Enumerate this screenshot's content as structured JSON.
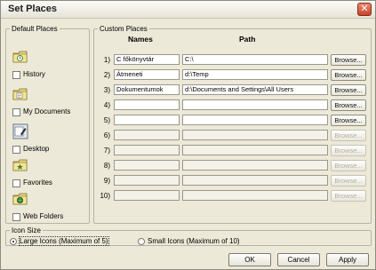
{
  "window": {
    "title": "Set Places",
    "close_glyph": "✕"
  },
  "default_places": {
    "legend": "Default Places",
    "items": [
      {
        "label": "History",
        "icon": "history-folder-icon"
      },
      {
        "label": "My Documents",
        "icon": "documents-folder-icon"
      },
      {
        "label": "Desktop",
        "icon": "desktop-icon"
      },
      {
        "label": "Favorites",
        "icon": "favorites-folder-icon"
      },
      {
        "label": "Web Folders",
        "icon": "web-folders-icon"
      }
    ]
  },
  "custom_places": {
    "legend": "Custom Places",
    "col_names": "Names",
    "col_path": "Path",
    "browse_label": "Browse...",
    "rows": [
      {
        "num": "1)",
        "name": "C főkönyvtár",
        "path": "C:\\",
        "enabled": true
      },
      {
        "num": "2)",
        "name": "Átmeneti",
        "path": "d:\\Temp",
        "enabled": true
      },
      {
        "num": "3)",
        "name": "Dokumentumok",
        "path": "d:\\Documents and Settings\\All Users",
        "enabled": true
      },
      {
        "num": "4)",
        "name": "",
        "path": "",
        "enabled": true
      },
      {
        "num": "5)",
        "name": "",
        "path": "",
        "enabled": true
      },
      {
        "num": "6)",
        "name": "",
        "path": "",
        "enabled": false
      },
      {
        "num": "7)",
        "name": "",
        "path": "",
        "enabled": false
      },
      {
        "num": "8)",
        "name": "",
        "path": "",
        "enabled": false
      },
      {
        "num": "9)",
        "name": "",
        "path": "",
        "enabled": false
      },
      {
        "num": "10)",
        "name": "",
        "path": "",
        "enabled": false
      }
    ]
  },
  "icon_size": {
    "legend": "Icon Size",
    "large_label": "Large Icons (Maximum of 5)",
    "small_label": "Small Icons (Maximum of 10)",
    "selected": "large"
  },
  "buttons": {
    "ok": "OK",
    "cancel": "Cancel",
    "apply": "Apply"
  },
  "colors": {
    "accent_close": "#c5432a",
    "window_bg": "#ece9d8"
  }
}
